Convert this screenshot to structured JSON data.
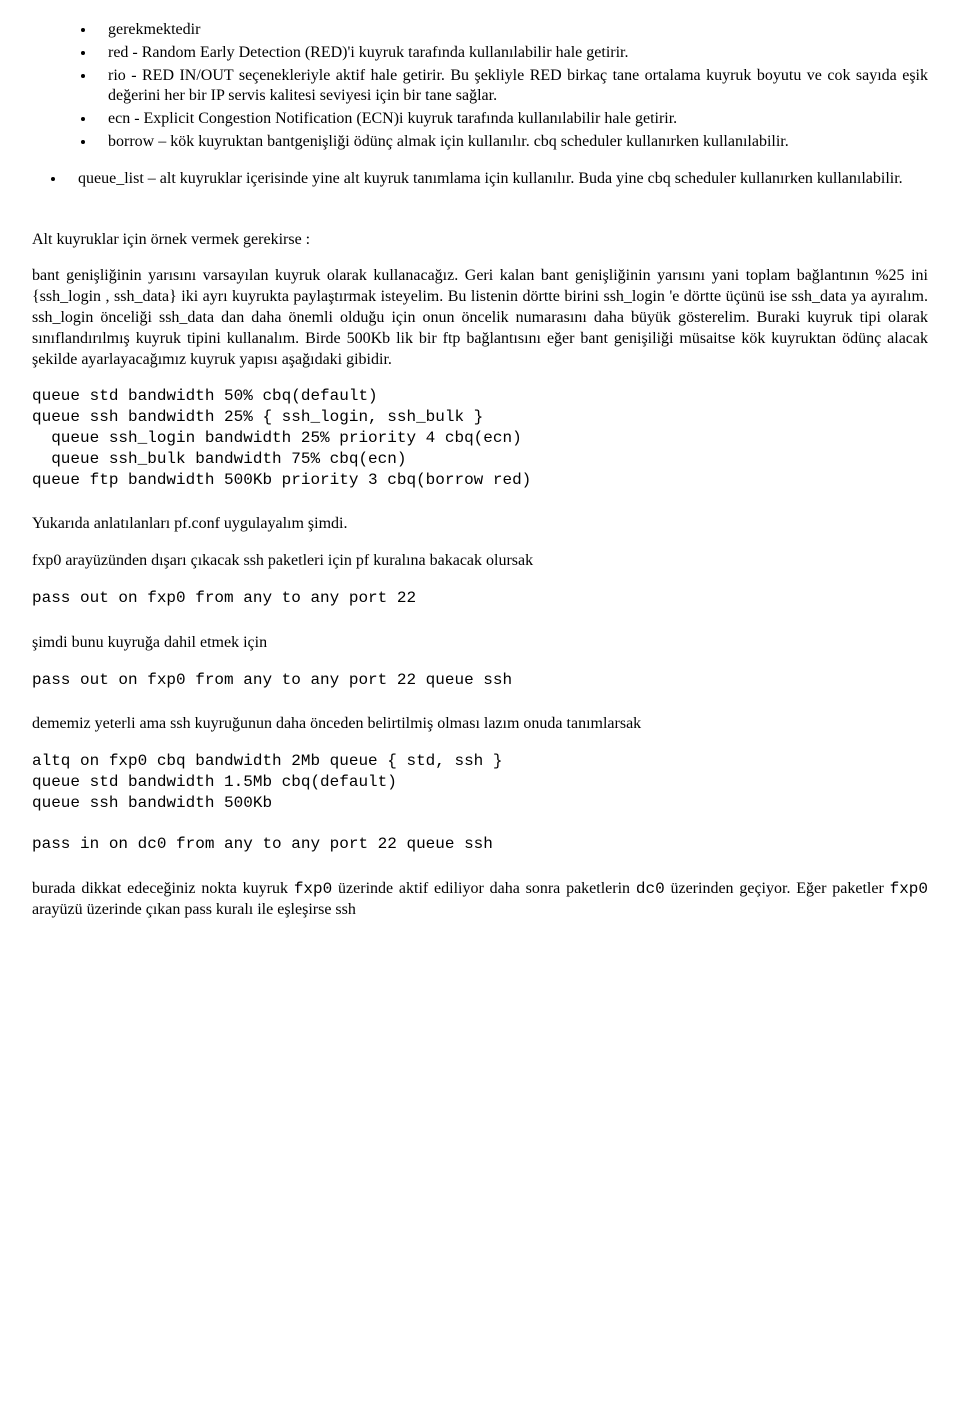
{
  "bullets1": [
    "gerekmektedir",
    "red - Random Early Detection (RED)'i kuyruk tarafında kullanılabilir hale getirir.",
    "rio - RED   IN/OUT seçenekleriyle aktif hale getirir. Bu şekliyle RED birkaç tane ortalama kuyruk boyutu ve cok sayıda eşik değerini her bir IP servis kalitesi seviyesi için bir tane sağlar.",
    "ecn - Explicit Congestion Notification (ECN)i kuyruk tarafında kullanılabilir hale getirir.",
    "borrow – kök kuyruktan bantgenişliği ödünç almak için kullanılır. cbq scheduler kullanırken kullanılabilir."
  ],
  "bullets2": [
    "queue_list – alt kuyruklar içerisinde yine alt kuyruk tanımlama için kullanılır. Buda yine cbq scheduler kullanırken kullanılabilir."
  ],
  "para1": "Alt kuyruklar için örnek vermek gerekirse :",
  "para2": "bant genişliğinin yarısını varsayılan kuyruk olarak kullanacağız. Geri kalan bant genişliğinin yarısını yani toplam bağlantının %25 ini {ssh_login , ssh_data} iki ayrı kuyrukta paylaştırmak isteyelim. Bu listenin dörtte birini ssh_login 'e dörtte üçünü ise ssh_data ya ayıralım. ssh_login önceliği ssh_data dan daha önemli olduğu için onun öncelik numarasını daha büyük gösterelim. Buraki kuyruk tipi olarak sınıflandırılmış kuyruk tipini kullanalım. Birde 500Kb lik bir ftp bağlantısını eğer bant genişiliği müsaitse kök kuyruktan ödünç alacak şekilde ayarlayacağımız kuyruk yapısı aşağıdaki gibidir.",
  "code1": "queue std bandwidth 50% cbq(default)\nqueue ssh bandwidth 25% { ssh_login, ssh_bulk }\n  queue ssh_login bandwidth 25% priority 4 cbq(ecn)\n  queue ssh_bulk bandwidth 75% cbq(ecn)\nqueue ftp bandwidth 500Kb priority 3 cbq(borrow red)",
  "para3": "Yukarıda anlatılanları pf.conf uygulayalım şimdi.",
  "para4": "fxp0 arayüzünden dışarı çıkacak ssh paketleri  için  pf kuralına bakacak olursak",
  "code2": "pass out on fxp0 from any to any port 22",
  "para5": "şimdi bunu kuyruğa dahil etmek için",
  "code3": "pass out on fxp0 from any to any port 22 queue ssh",
  "para6": "dememiz yeterli ama ssh kuyruğunun daha önceden belirtilmiş olması lazım onuda tanımlarsak",
  "code4": "altq on fxp0 cbq bandwidth 2Mb queue { std, ssh }\nqueue std bandwidth 1.5Mb cbq(default)\nqueue ssh bandwidth 500Kb\n\npass in on dc0 from any to any port 22 queue ssh",
  "para7_a": "burada dikkat edeceğiniz nokta kuyruk ",
  "para7_code1": "fxp0",
  "para7_b": " üzerinde aktif ediliyor daha sonra paketlerin ",
  "para7_code2": "dc0",
  "para7_c": " üzerinden geçiyor. Eğer paketler  ",
  "para7_code3": "fxp0",
  "para7_d": " arayüzü  üzerinde çıkan pass kuralı ile eşleşirse ssh"
}
